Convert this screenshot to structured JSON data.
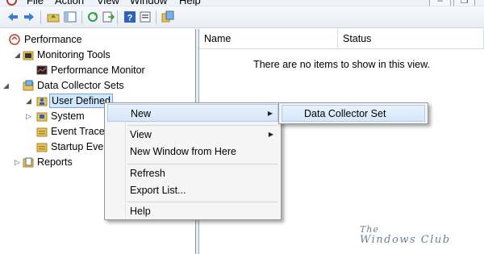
{
  "menubar": {
    "items": [
      "File",
      "Action",
      "View",
      "Window",
      "Help"
    ]
  },
  "window_controls": {
    "minimize": "–",
    "restore": "❐",
    "close": "✕"
  },
  "tree": {
    "root": "Performance",
    "monitoring_tools": "Monitoring Tools",
    "performance_monitor": "Performance Monitor",
    "data_collector_sets": "Data Collector Sets",
    "user_defined": "User Defined",
    "system": "System",
    "event_trace": "Event Trace",
    "startup_event": "Startup Eve",
    "reports": "Reports"
  },
  "list": {
    "col_name": "Name",
    "col_status": "Status",
    "empty_message": "There are no items to show in this view."
  },
  "context_menu": {
    "new": "New",
    "view": "View",
    "new_window": "New Window from Here",
    "refresh": "Refresh",
    "export_list": "Export List...",
    "help": "Help"
  },
  "submenu": {
    "data_collector_set": "Data Collector Set"
  },
  "watermark": {
    "line1": "The",
    "line2": "Windows Club"
  },
  "colors": {
    "highlight": "#d6e7fa",
    "selection": "#cde8ff",
    "menu_bg": "#f5f5f5"
  }
}
